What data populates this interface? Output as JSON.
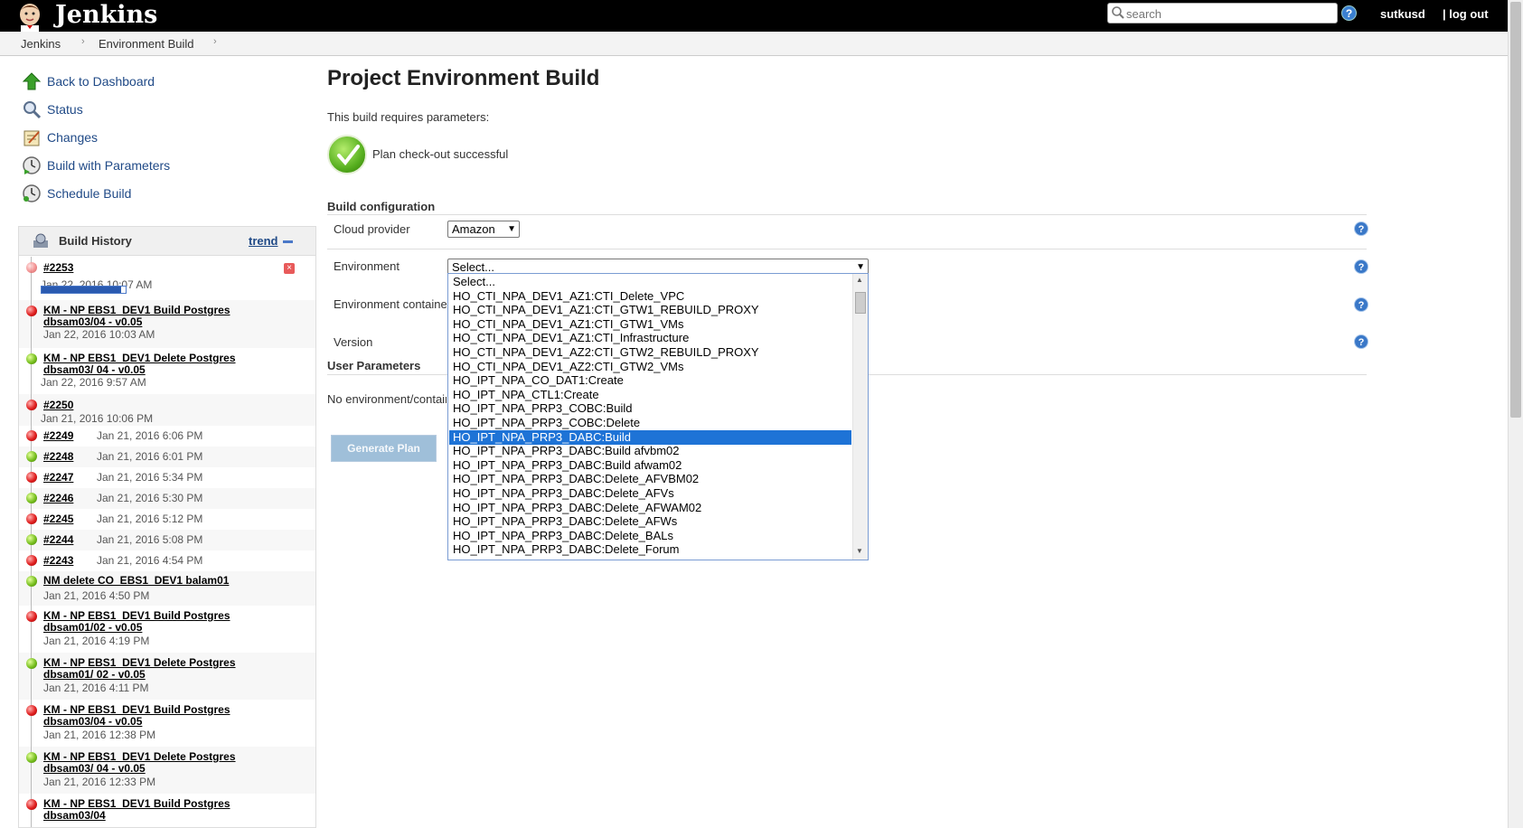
{
  "header": {
    "brand": "Jenkins",
    "search_placeholder": "search",
    "help_label": "?",
    "user": "sutkusd",
    "logout": "| log out"
  },
  "breadcrumb": [
    "Jenkins",
    "Environment Build"
  ],
  "sidebar": {
    "tasks": [
      {
        "label": "Back to Dashboard",
        "icon": "up-arrow-icon"
      },
      {
        "label": "Status",
        "icon": "magnifier-icon"
      },
      {
        "label": "Changes",
        "icon": "notepad-icon"
      },
      {
        "label": "Build with Parameters",
        "icon": "clock-play-icon"
      },
      {
        "label": "Schedule Build",
        "icon": "clock-icon"
      }
    ]
  },
  "build_history": {
    "title": "Build History",
    "trend": "trend",
    "running_progress": 0.95,
    "items": [
      {
        "status": "running",
        "label": "#2253",
        "date": "Jan 22, 2016 10:07 AM",
        "multiline": false
      },
      {
        "status": "red",
        "label": "KM - NP EBS1_DEV1 Build Postgres dbsam03/04 - v0.05",
        "date": "Jan 22, 2016 10:03 AM"
      },
      {
        "status": "green",
        "label": "KM - NP EBS1_DEV1 Delete Postgres dbsam03/ 04 - v0.05",
        "date": "Jan 22, 2016 9:57 AM"
      },
      {
        "status": "red",
        "label": "#2250",
        "date": "Jan 21, 2016 10:06 PM"
      },
      {
        "status": "red",
        "label": "#2249",
        "date": "Jan 21, 2016 6:06 PM"
      },
      {
        "status": "green",
        "label": "#2248",
        "date": "Jan 21, 2016 6:01 PM"
      },
      {
        "status": "red",
        "label": "#2247",
        "date": "Jan 21, 2016 5:34 PM"
      },
      {
        "status": "green",
        "label": "#2246",
        "date": "Jan 21, 2016 5:30 PM"
      },
      {
        "status": "red",
        "label": "#2245",
        "date": "Jan 21, 2016 5:12 PM"
      },
      {
        "status": "green",
        "label": "#2244",
        "date": "Jan 21, 2016 5:08 PM"
      },
      {
        "status": "red",
        "label": "#2243",
        "date": "Jan 21, 2016 4:54 PM"
      },
      {
        "status": "green",
        "label": "NM delete CO_EBS1_DEV1 balam01",
        "date": "Jan 21, 2016 4:50 PM"
      },
      {
        "status": "red",
        "label": "KM - NP EBS1_DEV1 Build Postgres dbsam01/02 - v0.05",
        "date": "Jan 21, 2016 4:19 PM"
      },
      {
        "status": "green",
        "label": "KM - NP EBS1_DEV1 Delete Postgres dbsam01/ 02 - v0.05",
        "date": "Jan 21, 2016 4:11 PM"
      },
      {
        "status": "red",
        "label": "KM - NP EBS1_DEV1 Build Postgres dbsam03/04 - v0.05",
        "date": "Jan 21, 2016 12:38 PM"
      },
      {
        "status": "green",
        "label": "KM - NP EBS1_DEV1 Delete Postgres dbsam03/ 04 - v0.05",
        "date": "Jan 21, 2016 12:33 PM"
      },
      {
        "status": "red",
        "label": "KM - NP EBS1_DEV1 Build Postgres dbsam03/04",
        "date": ""
      }
    ]
  },
  "main": {
    "title": "Project Environment Build",
    "subtitle": "This build requires parameters:",
    "checkout_message": "Plan check-out successful",
    "build_config_title": "Build configuration",
    "params": {
      "cloud_provider": {
        "label": "Cloud provider",
        "value": "Amazon"
      },
      "environment": {
        "label": "Environment",
        "value": "Select..."
      },
      "environment_container": {
        "label": "Environment container"
      },
      "version": {
        "label": "Version"
      }
    },
    "user_params_title": "User Parameters",
    "no_env_text": "No environment/container",
    "generate_button": "Generate Plan"
  },
  "environment_options": [
    "Select...",
    "HO_CTI_NPA_DEV1_AZ1:CTI_Delete_VPC",
    "HO_CTI_NPA_DEV1_AZ1:CTI_GTW1_REBUILD_PROXY",
    "HO_CTI_NPA_DEV1_AZ1:CTI_GTW1_VMs",
    "HO_CTI_NPA_DEV1_AZ1:CTI_Infrastructure",
    "HO_CTI_NPA_DEV1_AZ2:CTI_GTW2_REBUILD_PROXY",
    "HO_CTI_NPA_DEV1_AZ2:CTI_GTW2_VMs",
    "HO_IPT_NPA_CO_DAT1:Create",
    "HO_IPT_NPA_CTL1:Create",
    "HO_IPT_NPA_PRP3_COBC:Build",
    "HO_IPT_NPA_PRP3_COBC:Delete",
    "HO_IPT_NPA_PRP3_DABC:Build",
    "HO_IPT_NPA_PRP3_DABC:Build afvbm02",
    "HO_IPT_NPA_PRP3_DABC:Build afwam02",
    "HO_IPT_NPA_PRP3_DABC:Delete_AFVBM02",
    "HO_IPT_NPA_PRP3_DABC:Delete_AFVs",
    "HO_IPT_NPA_PRP3_DABC:Delete_AFWAM02",
    "HO_IPT_NPA_PRP3_DABC:Delete_AFWs",
    "HO_IPT_NPA_PRP3_DABC:Delete_BALs",
    "HO_IPT_NPA_PRP3_DABC:Delete_Forum"
  ],
  "selected_option_index": 11,
  "colors": {
    "header_bg": "#000000",
    "link": "#204a87",
    "selection": "#1e73d6",
    "button_disabled": "#9fbfd9"
  }
}
